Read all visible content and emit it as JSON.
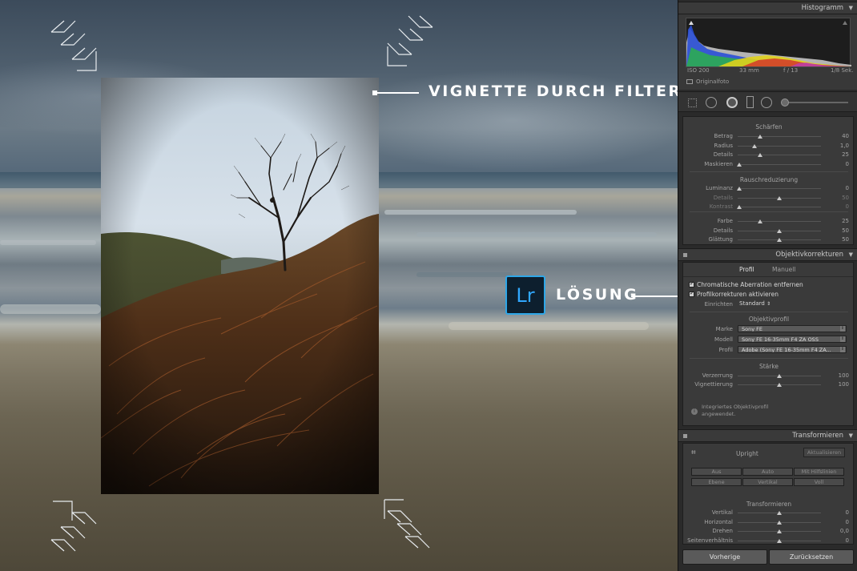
{
  "colors": {
    "accent_lightroom": "#31a8ff",
    "panel_bg": "#2a2a2a",
    "callout_text": "#ffffff"
  },
  "callouts": {
    "vignette_title": "VIGNETTE DURCH FILTER",
    "solution_title": "LÖSUNG",
    "lr_badge": "Lr"
  },
  "histogram": {
    "title": "Histogramm",
    "iso": "ISO 200",
    "focal": "33 mm",
    "aperture": "f / 13",
    "shutter": "1/8 Sek.",
    "original_label": "Originalfoto"
  },
  "sharpen": {
    "title": "Schärfen",
    "rows": [
      {
        "label": "Betrag",
        "value": "40",
        "fraction": 0.27
      },
      {
        "label": "Radius",
        "value": "1,0",
        "fraction": 0.2
      },
      {
        "label": "Details",
        "value": "25",
        "fraction": 0.27
      },
      {
        "label": "Maskieren",
        "value": "0",
        "fraction": 0.02
      }
    ]
  },
  "noise": {
    "title": "Rauschreduzierung",
    "rows": [
      {
        "label": "Luminanz",
        "value": "0",
        "fraction": 0.02,
        "dim": false
      },
      {
        "label": "Details",
        "value": "50",
        "fraction": 0.5,
        "dim": true
      },
      {
        "label": "Kontrast",
        "value": "0",
        "fraction": 0.02,
        "dim": true
      }
    ],
    "color_rows": [
      {
        "label": "Farbe",
        "value": "25",
        "fraction": 0.27
      },
      {
        "label": "Details",
        "value": "50",
        "fraction": 0.5
      },
      {
        "label": "Glättung",
        "value": "50",
        "fraction": 0.5
      }
    ]
  },
  "lens": {
    "title": "Objektivkorrekturen",
    "tab_profile": "Profil",
    "tab_manual": "Manuell",
    "chk_chromatic": "Chromatische Aberration entfernen",
    "chk_profile": "Profilkorrekturen aktivieren",
    "setup_label": "Einrichten",
    "setup_value": "Standard",
    "profile_head": "Objektivprofil",
    "make_label": "Marke",
    "make_value": "Sony FE",
    "model_label": "Modell",
    "model_value": "Sony FE 16-35mm F4 ZA OSS",
    "profile_label": "Profil",
    "profile_value": "Adobe (Sony FE 16-35mm F4 ZA...",
    "strength_head": "Stärke",
    "distortion_label": "Verzerrung",
    "distortion_value": "100",
    "distortion_fraction": 0.5,
    "vignetting_label": "Vignettierung",
    "vignetting_value": "100",
    "vignetting_fraction": 0.5,
    "info_text_1": "Integriertes Objektivprofil",
    "info_text_2": "angewendet."
  },
  "transform": {
    "title": "Transformieren",
    "upright_label": "Upright",
    "update_button": "Aktualisieren",
    "buttons_row1": [
      "Aus",
      "Auto",
      "Mit Hilfslinien"
    ],
    "buttons_row2": [
      "Ebene",
      "Vertikal",
      "Voll"
    ],
    "sub_head": "Transformieren",
    "rows": [
      {
        "label": "Vertikal",
        "value": "0",
        "fraction": 0.5
      },
      {
        "label": "Horizontal",
        "value": "0",
        "fraction": 0.5
      },
      {
        "label": "Drehen",
        "value": "0,0",
        "fraction": 0.5
      },
      {
        "label": "Seitenverhältnis",
        "value": "0",
        "fraction": 0.5
      }
    ]
  },
  "footer": {
    "previous": "Vorherige",
    "reset": "Zurücksetzen"
  }
}
